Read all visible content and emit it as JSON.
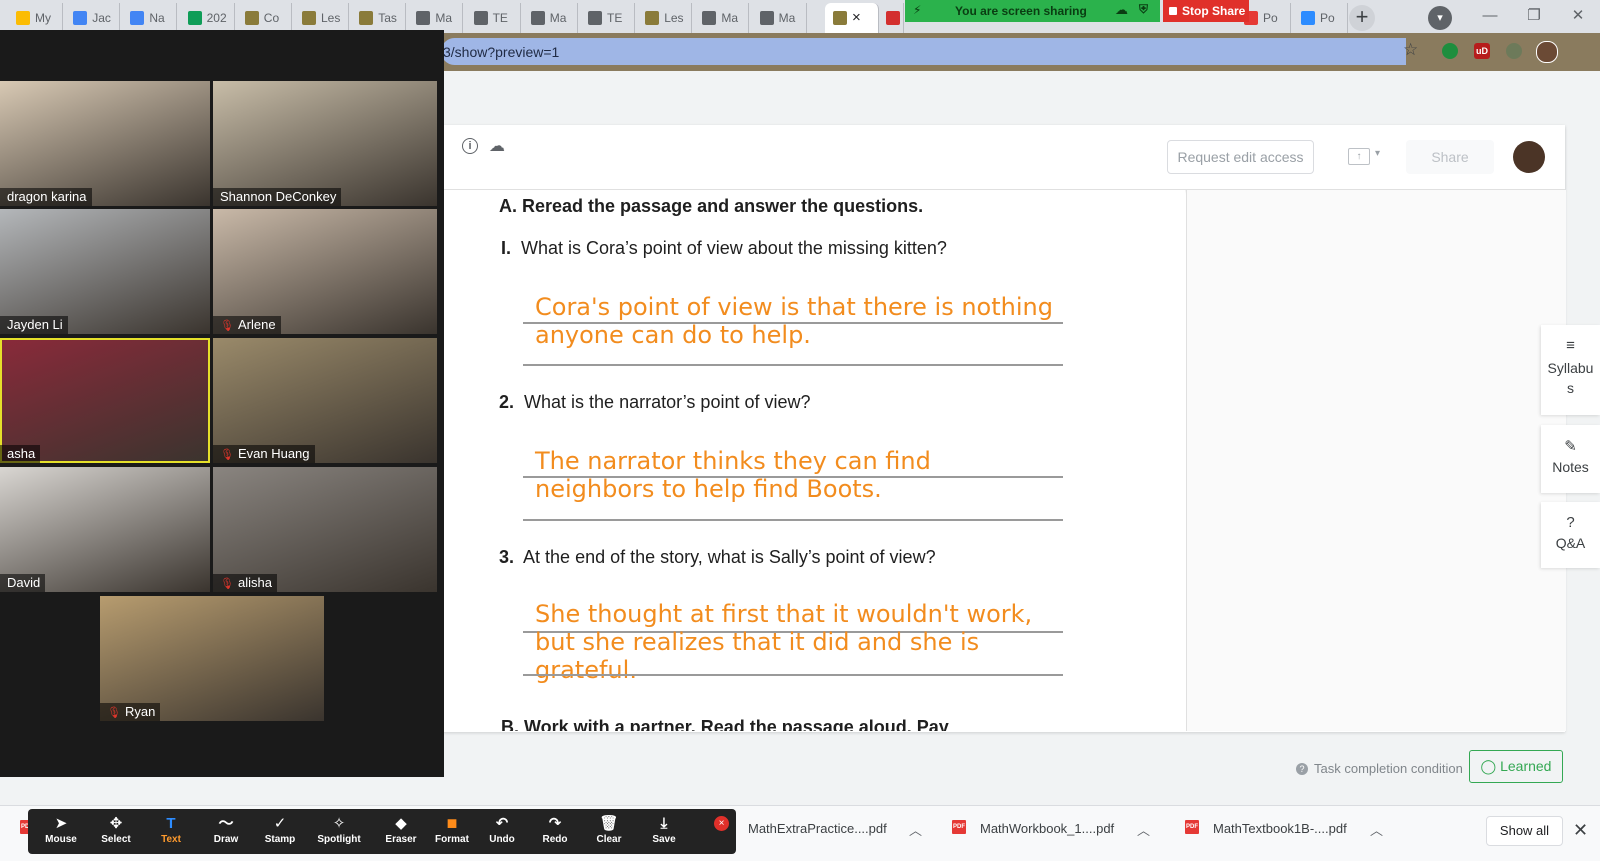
{
  "browser": {
    "tabs": [
      {
        "label": "My",
        "icon": "google-drive-icon",
        "color": "#fbbc04"
      },
      {
        "label": "Jac",
        "icon": "google-docs-icon",
        "color": "#4285f4"
      },
      {
        "label": "Na",
        "icon": "google-docs-icon",
        "color": "#4285f4"
      },
      {
        "label": "202",
        "icon": "google-sheets-icon",
        "color": "#0f9d58"
      },
      {
        "label": "Co",
        "icon": "classroom-icon",
        "color": "#8a7b3a"
      },
      {
        "label": "Les",
        "icon": "classroom-icon",
        "color": "#8a7b3a"
      },
      {
        "label": "Tas",
        "icon": "classroom-icon",
        "color": "#8a7b3a"
      },
      {
        "label": "Ma",
        "icon": "globe-icon",
        "color": "#5f6368"
      },
      {
        "label": "TE",
        "icon": "globe-icon",
        "color": "#5f6368"
      },
      {
        "label": "Ma",
        "icon": "globe-icon",
        "color": "#5f6368"
      },
      {
        "label": "TE",
        "icon": "globe-icon",
        "color": "#5f6368"
      },
      {
        "label": "Les",
        "icon": "classroom-icon",
        "color": "#8a7b3a"
      },
      {
        "label": "Ma",
        "icon": "globe-icon",
        "color": "#5f6368"
      },
      {
        "label": "Ma",
        "icon": "globe-icon",
        "color": "#5f6368"
      }
    ],
    "right_tabs": [
      {
        "label": "Po",
        "icon": "pdf-icon",
        "color": "#e53935"
      },
      {
        "label": "Po",
        "icon": "zoom-icon",
        "color": "#2d8cff"
      }
    ],
    "url": "3/show?preview=1",
    "new_tab": "+",
    "minimize": "—",
    "restore": "❐",
    "close": "✕",
    "tab_close": "×"
  },
  "zoom": {
    "share_banner": "You are screen sharing",
    "stop_share": "Stop Share",
    "participants": [
      {
        "name": "dragon karina",
        "muted": false,
        "bg": "#d8c9b4",
        "speaking": false
      },
      {
        "name": "Shannon DeConkey",
        "muted": false,
        "bg": "#c8bda8",
        "speaking": false
      },
      {
        "name": "Jayden Li",
        "muted": false,
        "bg": "#b4b7ba",
        "speaking": false
      },
      {
        "name": "Arlene",
        "muted": true,
        "bg": "#c9b9a8",
        "speaking": false
      },
      {
        "name": "asha",
        "muted": false,
        "bg": "#8a2a3a",
        "speaking": true
      },
      {
        "name": "Evan Huang",
        "muted": true,
        "bg": "#9a8a6a",
        "speaking": false
      },
      {
        "name": "David",
        "muted": false,
        "bg": "#d9d6d2",
        "speaking": false
      },
      {
        "name": "alisha",
        "muted": true,
        "bg": "#8a8580",
        "speaking": false
      },
      {
        "name": "Ryan",
        "muted": true,
        "bg": "#b79c6f",
        "speaking": false
      }
    ],
    "annotate_tools": [
      {
        "label": "Mouse",
        "icon": "cursor-icon",
        "glyph": "➤",
        "active": false
      },
      {
        "label": "Select",
        "icon": "move-icon",
        "glyph": "✥",
        "active": false
      },
      {
        "label": "Text",
        "icon": "text-icon",
        "glyph": "T",
        "active": true
      },
      {
        "label": "Draw",
        "icon": "draw-icon",
        "glyph": "〜",
        "active": false
      },
      {
        "label": "Stamp",
        "icon": "stamp-icon",
        "glyph": "✓",
        "active": false
      },
      {
        "label": "Spotlight",
        "icon": "spotlight-icon",
        "glyph": "✧",
        "active": false
      },
      {
        "label": "Eraser",
        "icon": "eraser-icon",
        "glyph": "◆",
        "active": false
      },
      {
        "label": "Format",
        "icon": "format-icon",
        "glyph": "■",
        "active": false
      },
      {
        "label": "Undo",
        "icon": "undo-icon",
        "glyph": "↶",
        "active": false
      },
      {
        "label": "Redo",
        "icon": "redo-icon",
        "glyph": "↷",
        "active": false
      },
      {
        "label": "Clear",
        "icon": "trash-icon",
        "glyph": "🗑",
        "active": false
      },
      {
        "label": "Save",
        "icon": "save-icon",
        "glyph": "⤓",
        "active": false
      }
    ]
  },
  "viewer": {
    "request_edit": "Request edit access",
    "share": "Share"
  },
  "worksheet": {
    "heading": "A. Reread the passage and answer the questions.",
    "questions": [
      {
        "num": "I.",
        "text": "What is Cora’s point of view about the missing kitten?",
        "answer": [
          "Cora's point of view is that there is nothing",
          "anyone can do to help."
        ]
      },
      {
        "num": "2.",
        "text": "What is the narrator’s point of view?",
        "answer": [
          "The narrator thinks they can find",
          "neighbors to help find Boots."
        ]
      },
      {
        "num": "3.",
        "text": "At the end of the story, what is Sally’s point of view?",
        "answer": [
          "She thought at first that it wouldn't work,",
          "but she realizes that it did and she is",
          "grateful."
        ]
      }
    ],
    "cut_off": "B. Work with a partner. Read the passage aloud. Pay",
    "accent_color": "#f28c1e"
  },
  "side_panel": [
    {
      "label": "Syllabus",
      "icon": "menu-icon"
    },
    {
      "label": "Notes",
      "icon": "pencil-icon"
    },
    {
      "label": "Q&A",
      "icon": "help-icon"
    }
  ],
  "footer": {
    "task_condition": "Task completion condition",
    "learned": "◯ Learned"
  },
  "downloads": {
    "files": [
      "MathExtraPractice....pdf",
      "MathWorkbook_1....pdf",
      "MathTextbook1B-....pdf"
    ],
    "show_all": "Show all"
  }
}
